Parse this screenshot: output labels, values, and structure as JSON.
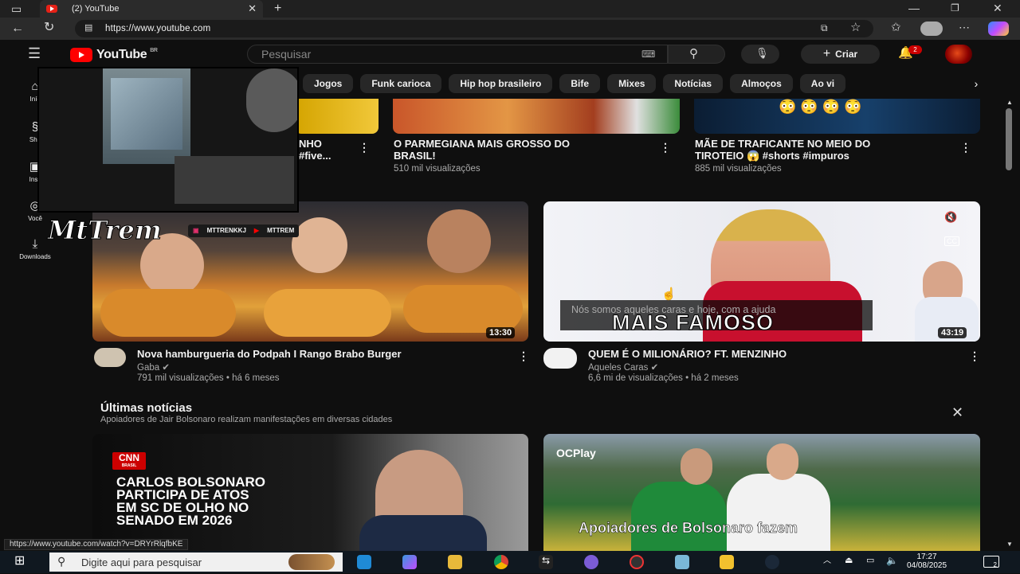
{
  "browser": {
    "tab_title": "(2) YouTube",
    "url": "https://www.youtube.com",
    "status_url": "https://www.youtube.com/watch?v=DRYrRlqfbKE"
  },
  "youtube": {
    "logo_text": "YouTube",
    "country_code": "BR",
    "search_placeholder": "Pesquisar",
    "create_label": "Criar",
    "notification_count": "2"
  },
  "sidebar": {
    "items": [
      {
        "label": "Iníc",
        "icon": "home-icon"
      },
      {
        "label": "Sho",
        "icon": "shorts-icon"
      },
      {
        "label": "Insc",
        "icon": "subscriptions-icon"
      },
      {
        "label": "Você",
        "icon": "you-icon"
      },
      {
        "label": "Downloads",
        "icon": "download-icon"
      }
    ]
  },
  "chips": [
    "Jogos",
    "Funk carioca",
    "Hip hop brasileiro",
    "Bife",
    "Mixes",
    "Notícias",
    "Almoços",
    "Ao vi"
  ],
  "row1": [
    {
      "title_line1": "NHO",
      "title_line2": "#five..."
    },
    {
      "title_line1": "O PARMEGIANA MAIS GROSSO DO",
      "title_line2": "BRASIL!",
      "meta": "510 mil visualizações"
    },
    {
      "title_line1": "MÃE DE TRAFICANTE NO MEIO DO",
      "title_line2": "TIROTEIO 😱 #shorts #impuros",
      "meta": "885 mil visualizações"
    }
  ],
  "videos": [
    {
      "title": "Nova hamburgueria do Podpah I Rango Brabo Burger",
      "channel": "Gaba",
      "meta": "791 mil visualizações • há 6 meses",
      "duration": "13:30"
    },
    {
      "title": "QUEM É O MILIONÁRIO? FT. MENZINHO",
      "channel": "Aqueles Caras",
      "meta": "6,6 mi de visualizações • há 2 meses",
      "duration": "43:19",
      "caption": "Nós somos aqueles caras e hoje, com a ajuda",
      "thumb_text": "MAIS FAMOSO"
    }
  ],
  "overlay": {
    "name": "MtTrem",
    "handles": [
      "MTTRENKKJ",
      "MTTREM"
    ]
  },
  "news": {
    "title": "Últimas notícias",
    "subtitle": "Apoiadores de Jair Bolsonaro realizam manifestações em diversas cidades",
    "cards": [
      {
        "source": "CNN",
        "source_sub": "BRASIL",
        "headline": [
          "CARLOS BOLSONARO",
          "PARTICIPA DE ATOS",
          "EM SC DE OLHO NO",
          "SENADO EM 2026"
        ]
      },
      {
        "source": "CPlay",
        "headline": [
          "Apoiadores de Bolsonaro fazem"
        ]
      }
    ]
  },
  "taskbar": {
    "search_placeholder": "Digite aqui para pesquisar",
    "time": "17:27",
    "date": "04/08/2025",
    "notif_count": "2"
  }
}
